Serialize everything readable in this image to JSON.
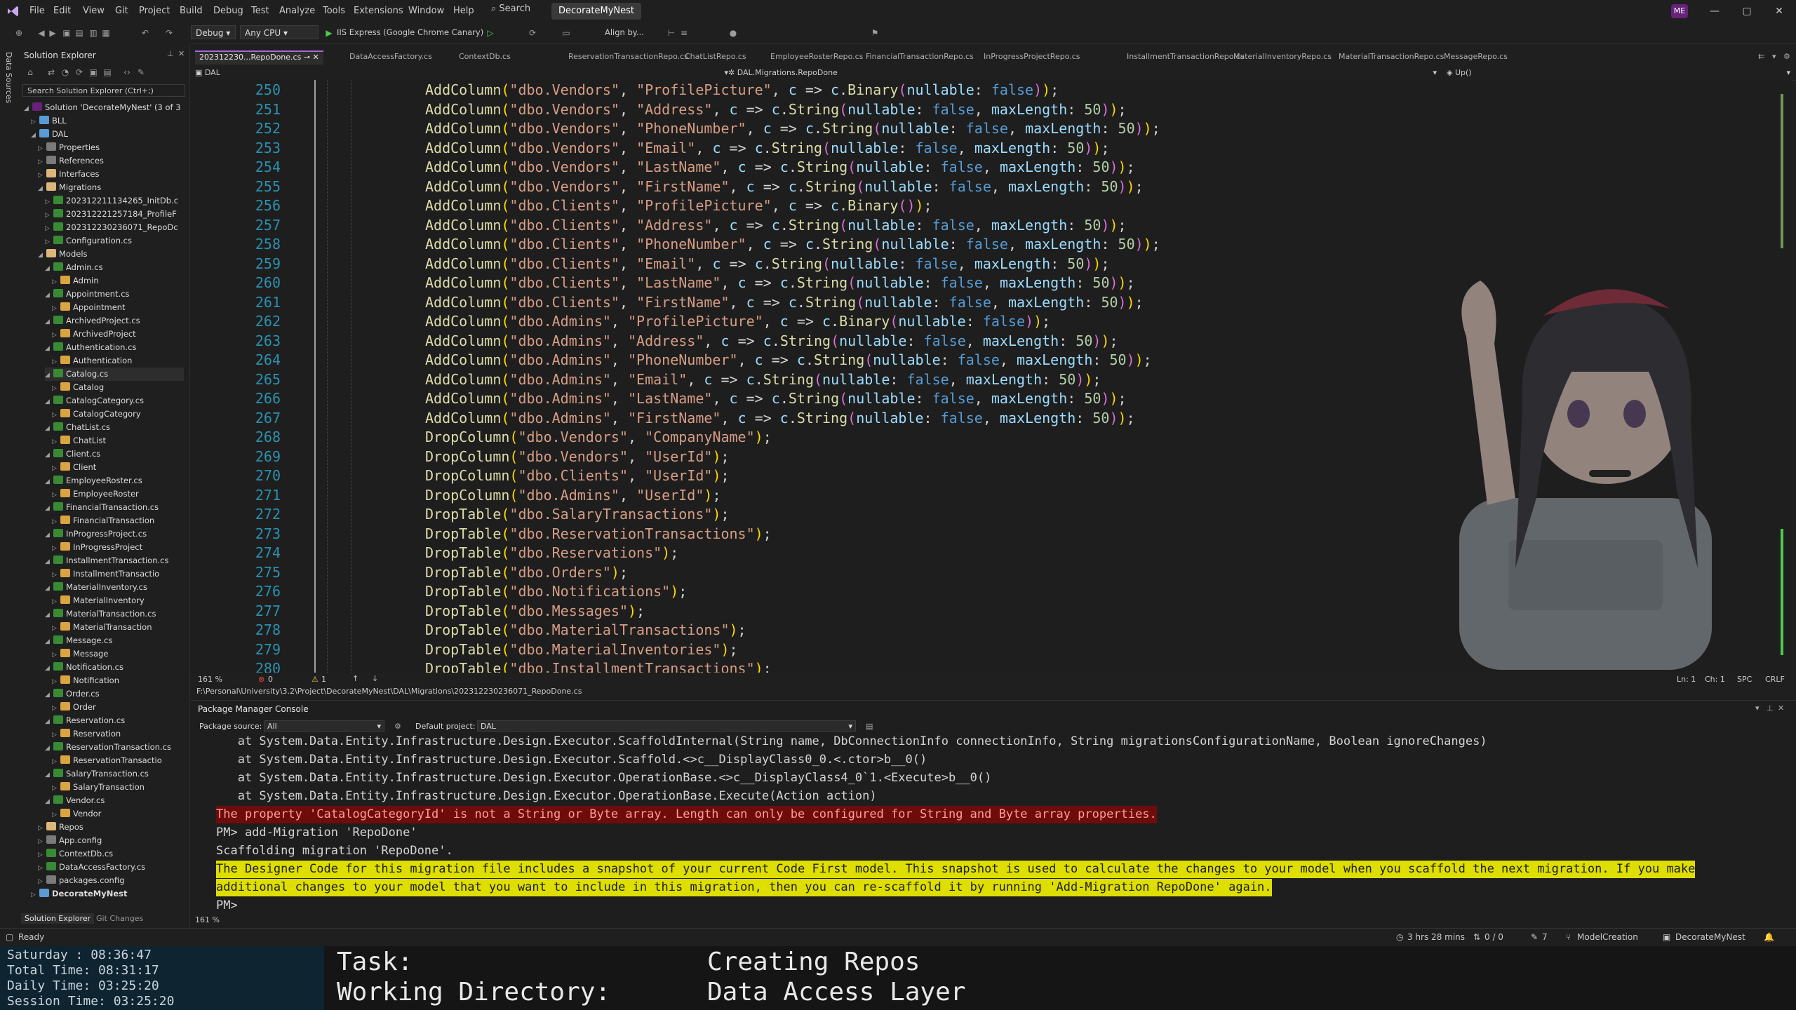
{
  "menubar": {
    "items": [
      "File",
      "Edit",
      "View",
      "Git",
      "Project",
      "Build",
      "Debug",
      "Test",
      "Analyze",
      "Tools",
      "Extensions",
      "Window",
      "Help"
    ],
    "search": "Search",
    "solution_name": "DecorateMyNest",
    "avatar_initials": "ME",
    "window_buttons": [
      "—",
      "▢",
      "✕"
    ]
  },
  "toolbar": {
    "config": "Debug",
    "platform": "Any CPU",
    "run_target": "IIS Express (Google Chrome Canary)",
    "align": "Align by..."
  },
  "left_rail": {
    "vertical_tab": "Data Sources"
  },
  "solution_explorer": {
    "title": "Solution Explorer",
    "search_placeholder": "Search Solution Explorer (Ctrl+;)",
    "tree": [
      {
        "label": "Solution 'DecorateMyNest' (3 of 3 p",
        "level": 0,
        "icon": "sln",
        "expanded": true
      },
      {
        "label": "BLL",
        "level": 1,
        "icon": "proj",
        "expanded": false
      },
      {
        "label": "DAL",
        "level": 1,
        "icon": "proj",
        "expanded": true
      },
      {
        "label": "Properties",
        "level": 2,
        "icon": "cfg",
        "expanded": false
      },
      {
        "label": "References",
        "level": 2,
        "icon": "cfg",
        "expanded": false
      },
      {
        "label": "Interfaces",
        "level": 2,
        "icon": "folder",
        "expanded": false
      },
      {
        "label": "Migrations",
        "level": 2,
        "icon": "folder",
        "expanded": true
      },
      {
        "label": "202312211134265_InitDb.c",
        "level": 3,
        "icon": "cs",
        "expanded": false
      },
      {
        "label": "202312221257184_ProfileF",
        "level": 3,
        "icon": "cs",
        "expanded": false
      },
      {
        "label": "202312230236071_RepoDc",
        "level": 3,
        "icon": "cs",
        "expanded": false
      },
      {
        "label": "Configuration.cs",
        "level": 3,
        "icon": "cs",
        "expanded": false
      },
      {
        "label": "Models",
        "level": 2,
        "icon": "folder",
        "expanded": true
      },
      {
        "label": "Admin.cs",
        "level": 3,
        "icon": "cs",
        "expanded": true
      },
      {
        "label": "Admin",
        "level": 4,
        "icon": "cls",
        "expanded": false
      },
      {
        "label": "Appointment.cs",
        "level": 3,
        "icon": "cs",
        "expanded": true
      },
      {
        "label": "Appointment",
        "level": 4,
        "icon": "cls",
        "expanded": false
      },
      {
        "label": "ArchivedProject.cs",
        "level": 3,
        "icon": "cs",
        "expanded": true
      },
      {
        "label": "ArchivedProject",
        "level": 4,
        "icon": "cls",
        "expanded": false
      },
      {
        "label": "Authentication.cs",
        "level": 3,
        "icon": "cs",
        "expanded": true
      },
      {
        "label": "Authentication",
        "level": 4,
        "icon": "cls",
        "expanded": false
      },
      {
        "label": "Catalog.cs",
        "level": 3,
        "icon": "cs",
        "expanded": true
      },
      {
        "label": "Catalog",
        "level": 4,
        "icon": "cls",
        "expanded": false
      },
      {
        "label": "CatalogCategory.cs",
        "level": 3,
        "icon": "cs",
        "expanded": true
      },
      {
        "label": "CatalogCategory",
        "level": 4,
        "icon": "cls",
        "expanded": false
      },
      {
        "label": "ChatList.cs",
        "level": 3,
        "icon": "cs",
        "expanded": true
      },
      {
        "label": "ChatList",
        "level": 4,
        "icon": "cls",
        "expanded": false
      },
      {
        "label": "Client.cs",
        "level": 3,
        "icon": "cs",
        "expanded": true
      },
      {
        "label": "Client",
        "level": 4,
        "icon": "cls",
        "expanded": false
      },
      {
        "label": "EmployeeRoster.cs",
        "level": 3,
        "icon": "cs",
        "expanded": true
      },
      {
        "label": "EmployeeRoster",
        "level": 4,
        "icon": "cls",
        "expanded": false
      },
      {
        "label": "FinancialTransaction.cs",
        "level": 3,
        "icon": "cs",
        "expanded": true
      },
      {
        "label": "FinancialTransaction",
        "level": 4,
        "icon": "cls",
        "expanded": false
      },
      {
        "label": "InProgressProject.cs",
        "level": 3,
        "icon": "cs",
        "expanded": true
      },
      {
        "label": "InProgressProject",
        "level": 4,
        "icon": "cls",
        "expanded": false
      },
      {
        "label": "InstallmentTransaction.cs",
        "level": 3,
        "icon": "cs",
        "expanded": true
      },
      {
        "label": "InstallmentTransactio",
        "level": 4,
        "icon": "cls",
        "expanded": false
      },
      {
        "label": "MaterialInventory.cs",
        "level": 3,
        "icon": "cs",
        "expanded": true
      },
      {
        "label": "MaterialInventory",
        "level": 4,
        "icon": "cls",
        "expanded": false
      },
      {
        "label": "MaterialTransaction.cs",
        "level": 3,
        "icon": "cs",
        "expanded": true
      },
      {
        "label": "MaterialTransaction",
        "level": 4,
        "icon": "cls",
        "expanded": false
      },
      {
        "label": "Message.cs",
        "level": 3,
        "icon": "cs",
        "expanded": true
      },
      {
        "label": "Message",
        "level": 4,
        "icon": "cls",
        "expanded": false
      },
      {
        "label": "Notification.cs",
        "level": 3,
        "icon": "cs",
        "expanded": true
      },
      {
        "label": "Notification",
        "level": 4,
        "icon": "cls",
        "expanded": false
      },
      {
        "label": "Order.cs",
        "level": 3,
        "icon": "cs",
        "expanded": true
      },
      {
        "label": "Order",
        "level": 4,
        "icon": "cls",
        "expanded": false
      },
      {
        "label": "Reservation.cs",
        "level": 3,
        "icon": "cs",
        "expanded": true
      },
      {
        "label": "Reservation",
        "level": 4,
        "icon": "cls",
        "expanded": false
      },
      {
        "label": "ReservationTransaction.cs",
        "level": 3,
        "icon": "cs",
        "expanded": true
      },
      {
        "label": "ReservationTransactio",
        "level": 4,
        "icon": "cls",
        "expanded": false
      },
      {
        "label": "SalaryTransaction.cs",
        "level": 3,
        "icon": "cs",
        "expanded": true
      },
      {
        "label": "SalaryTransaction",
        "level": 4,
        "icon": "cls",
        "expanded": false
      },
      {
        "label": "Vendor.cs",
        "level": 3,
        "icon": "cs",
        "expanded": true
      },
      {
        "label": "Vendor",
        "level": 4,
        "icon": "cls",
        "expanded": false
      },
      {
        "label": "Repos",
        "level": 2,
        "icon": "folder",
        "expanded": false
      },
      {
        "label": "App.config",
        "level": 2,
        "icon": "cfg",
        "expanded": false
      },
      {
        "label": "ContextDb.cs",
        "level": 2,
        "icon": "cs",
        "expanded": false
      },
      {
        "label": "DataAccessFactory.cs",
        "level": 2,
        "icon": "cs",
        "expanded": false
      },
      {
        "label": "packages.config",
        "level": 2,
        "icon": "cfg",
        "expanded": false
      },
      {
        "label": "DecorateMyNest",
        "level": 1,
        "icon": "proj",
        "expanded": false,
        "bold": true
      }
    ],
    "bottom_tabs": [
      "Solution Explorer",
      "Git Changes"
    ]
  },
  "editor_tabs": [
    "202312230236071_RepoDone.cs",
    "DataAccessFactory.cs",
    "ContextDb.cs",
    "ReservationTransactionRepo.cs",
    "ChatListRepo.cs",
    "EmployeeRosterRepo.cs",
    "FinancialTransactionRepo.cs",
    "InProgressProjectRepo.cs",
    "InstallmentTransactionRepo.cs",
    "MaterialInventoryRepo.cs",
    "MaterialTransactionRepo.cs",
    "MessageRepo.cs"
  ],
  "editor_tabs_display": [
    "202312230...RepoDone.cs"
  ],
  "navbar": {
    "project": "DAL",
    "type": "DAL.Migrations.RepoDone",
    "member": "Up()"
  },
  "code_lines": [
    {
      "n": "250",
      "c": "AddColumn(\"dbo.Vendors\", \"ProfilePicture\", c => c.Binary(nullable: false));"
    },
    {
      "n": "251",
      "c": "AddColumn(\"dbo.Vendors\", \"Address\", c => c.String(nullable: false, maxLength: 50));"
    },
    {
      "n": "252",
      "c": "AddColumn(\"dbo.Vendors\", \"PhoneNumber\", c => c.String(nullable: false, maxLength: 50));"
    },
    {
      "n": "253",
      "c": "AddColumn(\"dbo.Vendors\", \"Email\", c => c.String(nullable: false, maxLength: 50));"
    },
    {
      "n": "254",
      "c": "AddColumn(\"dbo.Vendors\", \"LastName\", c => c.String(nullable: false, maxLength: 50));"
    },
    {
      "n": "255",
      "c": "AddColumn(\"dbo.Vendors\", \"FirstName\", c => c.String(nullable: false, maxLength: 50));"
    },
    {
      "n": "256",
      "c": "AddColumn(\"dbo.Clients\", \"ProfilePicture\", c => c.Binary());"
    },
    {
      "n": "257",
      "c": "AddColumn(\"dbo.Clients\", \"Address\", c => c.String(nullable: false, maxLength: 50));"
    },
    {
      "n": "258",
      "c": "AddColumn(\"dbo.Clients\", \"PhoneNumber\", c => c.String(nullable: false, maxLength: 50));"
    },
    {
      "n": "259",
      "c": "AddColumn(\"dbo.Clients\", \"Email\", c => c.String(nullable: false, maxLength: 50));"
    },
    {
      "n": "260",
      "c": "AddColumn(\"dbo.Clients\", \"LastName\", c => c.String(nullable: false, maxLength: 50));"
    },
    {
      "n": "261",
      "c": "AddColumn(\"dbo.Clients\", \"FirstName\", c => c.String(nullable: false, maxLength: 50));"
    },
    {
      "n": "262",
      "c": "AddColumn(\"dbo.Admins\", \"ProfilePicture\", c => c.Binary(nullable: false));"
    },
    {
      "n": "263",
      "c": "AddColumn(\"dbo.Admins\", \"Address\", c => c.String(nullable: false, maxLength: 50));"
    },
    {
      "n": "264",
      "c": "AddColumn(\"dbo.Admins\", \"PhoneNumber\", c => c.String(nullable: false, maxLength: 50));"
    },
    {
      "n": "265",
      "c": "AddColumn(\"dbo.Admins\", \"Email\", c => c.String(nullable: false, maxLength: 50));"
    },
    {
      "n": "266",
      "c": "AddColumn(\"dbo.Admins\", \"LastName\", c => c.String(nullable: false, maxLength: 50));"
    },
    {
      "n": "267",
      "c": "AddColumn(\"dbo.Admins\", \"FirstName\", c => c.String(nullable: false, maxLength: 50));"
    },
    {
      "n": "268",
      "c": "DropColumn(\"dbo.Vendors\", \"CompanyName\");"
    },
    {
      "n": "269",
      "c": "DropColumn(\"dbo.Vendors\", \"UserId\");"
    },
    {
      "n": "270",
      "c": "DropColumn(\"dbo.Clients\", \"UserId\");"
    },
    {
      "n": "271",
      "c": "DropColumn(\"dbo.Admins\", \"UserId\");"
    },
    {
      "n": "272",
      "c": "DropTable(\"dbo.SalaryTransactions\");"
    },
    {
      "n": "273",
      "c": "DropTable(\"dbo.ReservationTransactions\");"
    },
    {
      "n": "274",
      "c": "DropTable(\"dbo.Reservations\");"
    },
    {
      "n": "275",
      "c": "DropTable(\"dbo.Orders\");"
    },
    {
      "n": "276",
      "c": "DropTable(\"dbo.Notifications\");"
    },
    {
      "n": "277",
      "c": "DropTable(\"dbo.Messages\");"
    },
    {
      "n": "278",
      "c": "DropTable(\"dbo.MaterialTransactions\");"
    },
    {
      "n": "279",
      "c": "DropTable(\"dbo.MaterialInventories\");"
    },
    {
      "n": "280",
      "c": "DropTable(\"dbo.InstallmentTransactions\");"
    }
  ],
  "editor_status": {
    "zoom": "161 %",
    "errors": "0",
    "warnings": "1",
    "ln": "Ln: 1",
    "ch": "Ch: 1",
    "spc": "SPC",
    "eol": "CRLF"
  },
  "file_path": "F:\\Personal\\University\\3.2\\Project\\DecorateMyNest\\DAL\\Migrations\\202312230236071_RepoDone.cs",
  "pmc": {
    "title": "Package Manager Console",
    "source_label": "Package source:",
    "source_value": "All",
    "project_label": "Default project:",
    "project_value": "DAL",
    "zoom": "161 %",
    "lines": [
      {
        "t": "   at System.Data.Entity.Infrastructure.Design.Executor.ScaffoldInternal(String name, DbConnectionInfo connectionInfo, String migrationsConfigurationName, Boolean ignoreChanges)",
        "k": "normal"
      },
      {
        "t": "   at System.Data.Entity.Infrastructure.Design.Executor.Scaffold.<>c__DisplayClass0_0.<.ctor>b__0()",
        "k": "normal"
      },
      {
        "t": "   at System.Data.Entity.Infrastructure.Design.Executor.OperationBase.<>c__DisplayClass4_0`1.<Execute>b__0()",
        "k": "normal"
      },
      {
        "t": "   at System.Data.Entity.Infrastructure.Design.Executor.OperationBase.Execute(Action action)",
        "k": "normal"
      },
      {
        "t": "The property 'CatalogCategoryId' is not a String or Byte array. Length can only be configured for String and Byte array properties.",
        "k": "err"
      },
      {
        "t": "PM> add-Migration 'RepoDone'",
        "k": "normal"
      },
      {
        "t": "Scaffolding migration 'RepoDone'.",
        "k": "normal"
      },
      {
        "t": "The Designer Code for this migration file includes a snapshot of your current Code First model. This snapshot is used to calculate the changes to your model when you scaffold the next migration. If you make",
        "k": "warn"
      },
      {
        "t": "additional changes to your model that you want to include in this migration, then you can re-scaffold it by running 'Add-Migration RepoDone' again.",
        "k": "warn"
      },
      {
        "t": "PM>",
        "k": "normal"
      }
    ]
  },
  "statusbar": {
    "ready": "Ready",
    "time": "3 hrs 28 mins",
    "sync": "0 / 0",
    "edits": "7",
    "branch": "ModelCreation",
    "repo": "DecorateMyNest"
  },
  "overlay": {
    "timers": [
      "Saturday  :  08:36:47",
      "Total Time: 08:31:17",
      "Daily Time: 03:25:20",
      "Session Time: 03:25:20"
    ],
    "task_label": "Task:",
    "task_value": "Creating Repos",
    "dir_label": "Working Directory:",
    "dir_value": "Data Access Layer"
  },
  "colors": {
    "accent": "#a868d8",
    "method": "#dcdcaa",
    "string": "#d69d85",
    "keyword": "#569cd6",
    "line_number": "#2b91af",
    "error_bg": "#6e0c0c",
    "warn_bg": "#dede00"
  }
}
